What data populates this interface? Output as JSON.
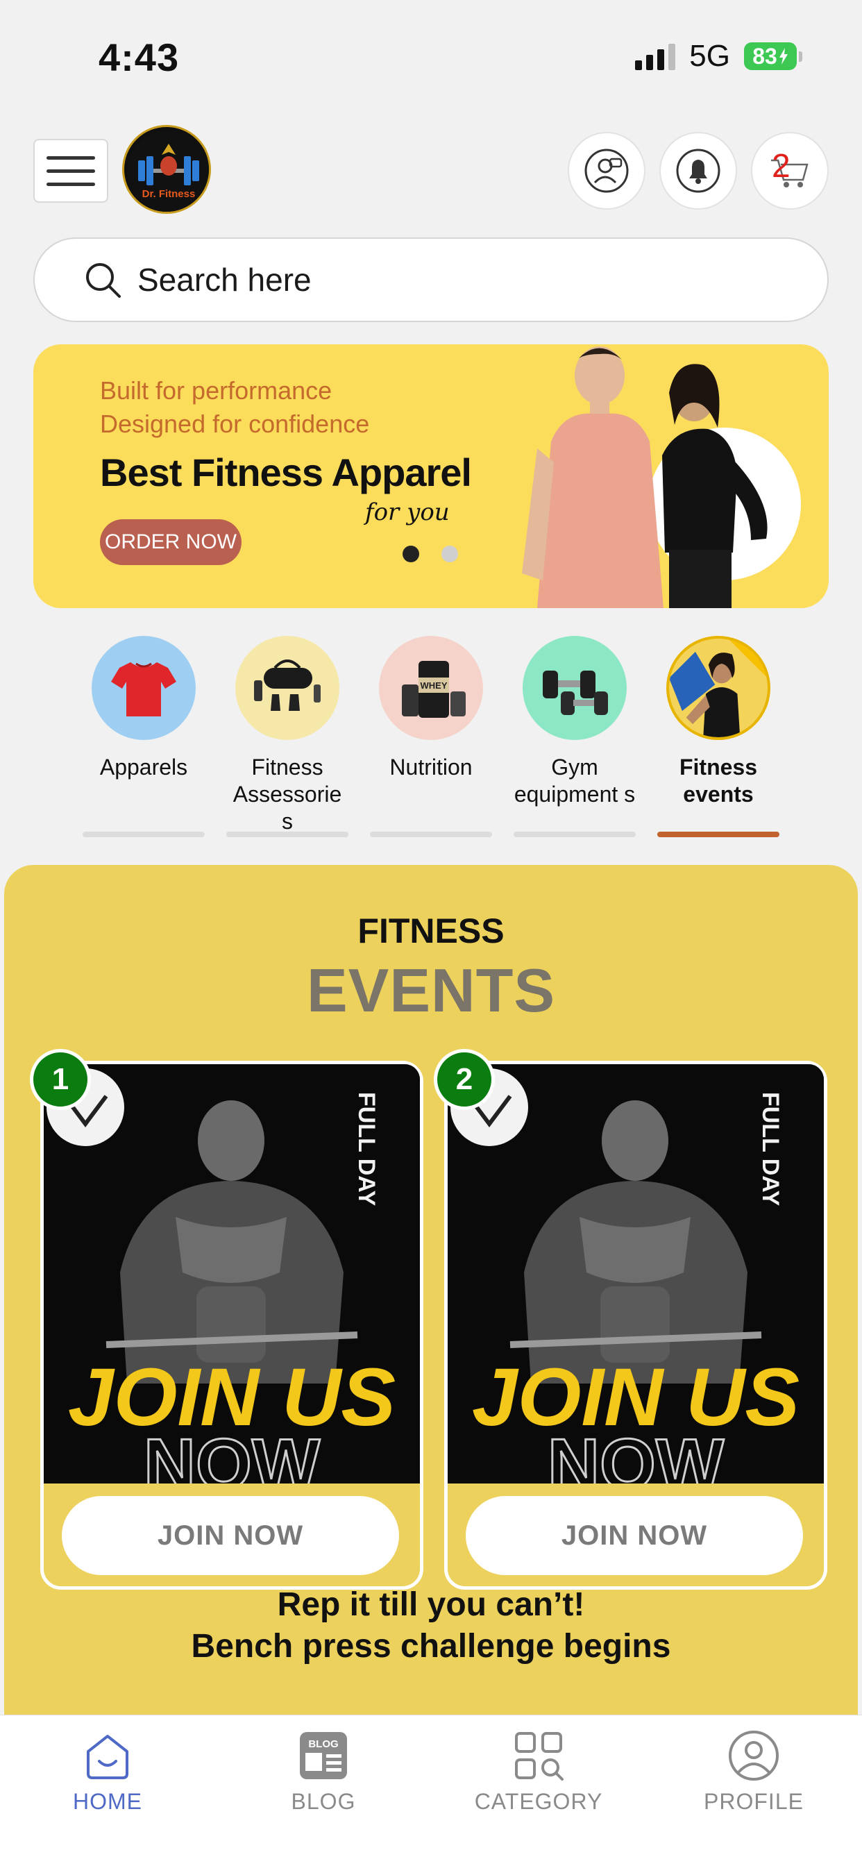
{
  "status_bar": {
    "time": "4:43",
    "network": "5G",
    "battery": "83"
  },
  "header": {
    "logo_text": "Dr. Fitness",
    "cart_count": "2"
  },
  "search": {
    "placeholder": "Search here"
  },
  "banner": {
    "tagline_1": "Built for performance",
    "tagline_2": "Designed for confidence",
    "title": "Best Fitness Apparel",
    "script_text": "for you",
    "button_label": "ORDER NOW",
    "slide_count": 2,
    "active_slide": 1
  },
  "categories": {
    "items": [
      {
        "label": "Apparels",
        "icon": "tshirt-icon",
        "active": false
      },
      {
        "label": "Fitness Assessorie s",
        "icon": "gym-bag-icon",
        "active": false
      },
      {
        "label": "Nutrition",
        "icon": "whey-protein-icon",
        "active": false
      },
      {
        "label": "Gym equipment s",
        "icon": "dumbbell-icon",
        "active": false
      },
      {
        "label": "Fitness events",
        "icon": "athlete-icon",
        "active": true
      }
    ]
  },
  "events": {
    "kicker": "FITNESS",
    "title": "EVENTS",
    "cards": [
      {
        "number": "1",
        "poster_text": "JOIN US",
        "poster_text_2": "NOW",
        "poster_side": "FULL DAY",
        "button_label": "JOIN NOW"
      },
      {
        "number": "2",
        "poster_text": "JOIN US",
        "poster_text_2": "NOW",
        "poster_side": "FULL DAY",
        "button_label": "JOIN NOW"
      }
    ],
    "caption_line_1": "Rep it till you can’t!",
    "caption_line_2": "Bench press challenge begins"
  },
  "bottom_nav": {
    "items": [
      {
        "label": "HOME",
        "icon": "home-icon",
        "active": true
      },
      {
        "label": "BLOG",
        "icon": "blog-icon",
        "active": false
      },
      {
        "label": "CATEGORY",
        "icon": "category-icon",
        "active": false
      },
      {
        "label": "PROFILE",
        "icon": "profile-icon",
        "active": false
      }
    ]
  },
  "colors": {
    "banner_bg": "#fbdc5b",
    "events_bg": "#ecd15c",
    "accent_underline": "#c0632e",
    "badge_green": "#0b7d10",
    "nav_active": "#4f69c6"
  }
}
